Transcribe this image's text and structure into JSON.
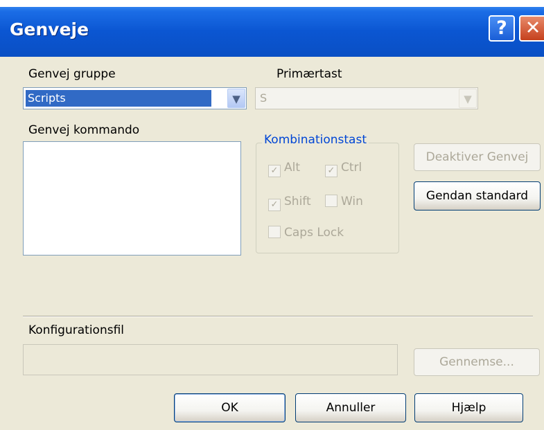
{
  "window": {
    "title": "Genveje"
  },
  "group_label": "Genvej gruppe",
  "group_value": "Scripts",
  "primary_key_label": "Primærtast",
  "primary_key_value": "S",
  "command_label": "Genvej kommando",
  "combo_group_label": "Kombinationstast",
  "modifiers": [
    {
      "label": "Alt",
      "checked": true
    },
    {
      "label": "Ctrl",
      "checked": true
    },
    {
      "label": "Shift",
      "checked": true
    },
    {
      "label": "Win",
      "checked": false
    },
    {
      "label": "Caps Lock",
      "checked": false
    }
  ],
  "buttons": {
    "disable": "Deaktiver Genvej",
    "restore": "Gendan standard",
    "browse": "Gennemse...",
    "ok": "OK",
    "cancel": "Annuller",
    "help": "Hjælp"
  },
  "config_label": "Konfigurationsfil",
  "config_value": ""
}
